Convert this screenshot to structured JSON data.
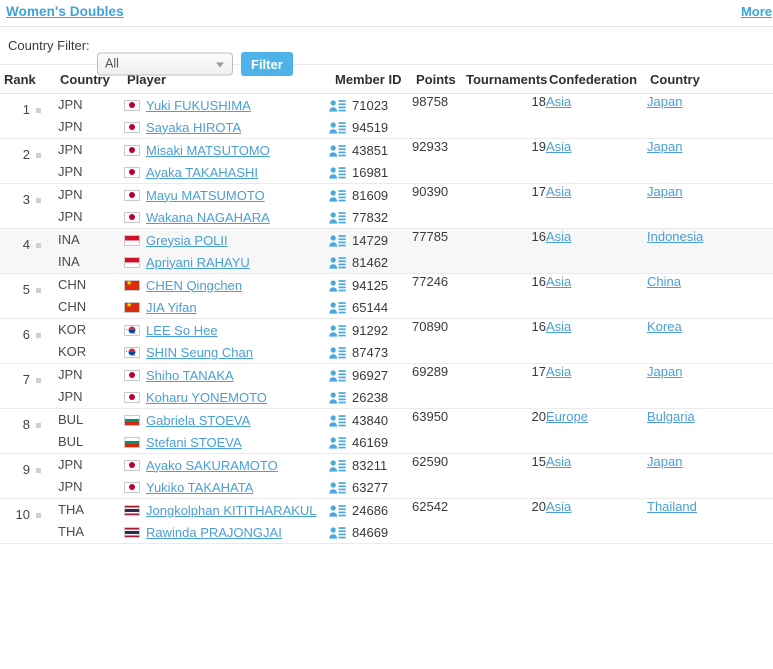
{
  "topbar": {
    "title": "Women's Doubles",
    "more_label": "More"
  },
  "filter": {
    "label": "Country Filter:",
    "selected": "All",
    "options": [
      "All"
    ],
    "button_label": "Filter",
    "caret_icon": "chevron-down-icon"
  },
  "table": {
    "headers": {
      "rank": "Rank",
      "country": "Country",
      "player": "Player",
      "member_id": "Member ID",
      "points": "Points",
      "tournaments": "Tournaments",
      "confederation": "Confederation",
      "country2": "Country"
    },
    "rows": [
      {
        "rank": "1",
        "highlight": false,
        "players": [
          {
            "code": "JPN",
            "flag": "jpn",
            "name": "Yuki FUKUSHIMA",
            "member_id": "71023"
          },
          {
            "code": "JPN",
            "flag": "jpn",
            "name": "Sayaka HIROTA",
            "member_id": "94519"
          }
        ],
        "points": "98758",
        "tournaments": "18",
        "confederation": "Asia",
        "country": "Japan"
      },
      {
        "rank": "2",
        "highlight": false,
        "players": [
          {
            "code": "JPN",
            "flag": "jpn",
            "name": "Misaki MATSUTOMO",
            "member_id": "43851"
          },
          {
            "code": "JPN",
            "flag": "jpn",
            "name": "Ayaka TAKAHASHI",
            "member_id": "16981"
          }
        ],
        "points": "92933",
        "tournaments": "19",
        "confederation": "Asia",
        "country": "Japan"
      },
      {
        "rank": "3",
        "highlight": false,
        "players": [
          {
            "code": "JPN",
            "flag": "jpn",
            "name": "Mayu MATSUMOTO",
            "member_id": "81609"
          },
          {
            "code": "JPN",
            "flag": "jpn",
            "name": "Wakana NAGAHARA",
            "member_id": "77832"
          }
        ],
        "points": "90390",
        "tournaments": "17",
        "confederation": "Asia",
        "country": "Japan"
      },
      {
        "rank": "4",
        "highlight": true,
        "players": [
          {
            "code": "INA",
            "flag": "ina",
            "name": "Greysia POLII",
            "member_id": "14729"
          },
          {
            "code": "INA",
            "flag": "ina",
            "name": "Apriyani RAHAYU",
            "member_id": "81462"
          }
        ],
        "points": "77785",
        "tournaments": "16",
        "confederation": "Asia",
        "country": "Indonesia"
      },
      {
        "rank": "5",
        "highlight": false,
        "players": [
          {
            "code": "CHN",
            "flag": "chn",
            "name": "CHEN Qingchen",
            "member_id": "94125"
          },
          {
            "code": "CHN",
            "flag": "chn",
            "name": "JIA Yifan",
            "member_id": "65144"
          }
        ],
        "points": "77246",
        "tournaments": "16",
        "confederation": "Asia",
        "country": "China"
      },
      {
        "rank": "6",
        "highlight": false,
        "players": [
          {
            "code": "KOR",
            "flag": "kor",
            "name": "LEE So Hee",
            "member_id": "91292"
          },
          {
            "code": "KOR",
            "flag": "kor",
            "name": "SHIN Seung Chan",
            "member_id": "87473"
          }
        ],
        "points": "70890",
        "tournaments": "16",
        "confederation": "Asia",
        "country": "Korea"
      },
      {
        "rank": "7",
        "highlight": false,
        "players": [
          {
            "code": "JPN",
            "flag": "jpn",
            "name": "Shiho TANAKA",
            "member_id": "96927"
          },
          {
            "code": "JPN",
            "flag": "jpn",
            "name": "Koharu YONEMOTO",
            "member_id": "26238"
          }
        ],
        "points": "69289",
        "tournaments": "17",
        "confederation": "Asia",
        "country": "Japan"
      },
      {
        "rank": "8",
        "highlight": false,
        "players": [
          {
            "code": "BUL",
            "flag": "bul",
            "name": "Gabriela STOEVA",
            "member_id": "43840"
          },
          {
            "code": "BUL",
            "flag": "bul",
            "name": "Stefani STOEVA",
            "member_id": "46169"
          }
        ],
        "points": "63950",
        "tournaments": "20",
        "confederation": "Europe",
        "country": "Bulgaria"
      },
      {
        "rank": "9",
        "highlight": false,
        "players": [
          {
            "code": "JPN",
            "flag": "jpn",
            "name": "Ayako SAKURAMOTO",
            "member_id": "83211"
          },
          {
            "code": "JPN",
            "flag": "jpn",
            "name": "Yukiko TAKAHATA",
            "member_id": "63277"
          }
        ],
        "points": "62590",
        "tournaments": "15",
        "confederation": "Asia",
        "country": "Japan"
      },
      {
        "rank": "10",
        "highlight": false,
        "players": [
          {
            "code": "THA",
            "flag": "tha",
            "name": "Jongkolphan KITITHARAKUL",
            "member_id": "24686"
          },
          {
            "code": "THA",
            "flag": "tha",
            "name": "Rawinda PRAJONGJAI",
            "member_id": "84669"
          }
        ],
        "points": "62542",
        "tournaments": "20",
        "confederation": "Asia",
        "country": "Thailand"
      }
    ]
  },
  "colors": {
    "accent": "#4a9fd4",
    "header_link": "#3ca4dd",
    "button": "#4eb3e8",
    "row_highlight": "#f7f7f7"
  }
}
